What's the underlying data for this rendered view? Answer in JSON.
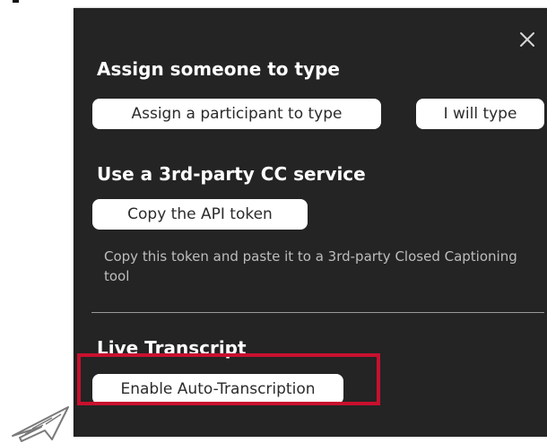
{
  "close": {
    "icon": "close-icon"
  },
  "assign": {
    "heading": "Assign someone to type",
    "participant_button": "Assign a participant to type",
    "self_button": "I will type"
  },
  "third_party": {
    "heading": "Use a 3rd-party CC service",
    "api_button": "Copy the API token",
    "description": "Copy this token and paste it to a 3rd-party Closed Captioning tool"
  },
  "live_transcript": {
    "heading": "Live Transcript",
    "enable_button": "Enable Auto-Transcription"
  },
  "annotation": {
    "highlight_color": "#c8102e",
    "pointer_icon": "arrow-pointer-icon"
  },
  "colors": {
    "panel_background": "#242424",
    "button_background": "#ffffff",
    "heading_text": "#ffffff",
    "description_text": "#bdbdbd"
  }
}
